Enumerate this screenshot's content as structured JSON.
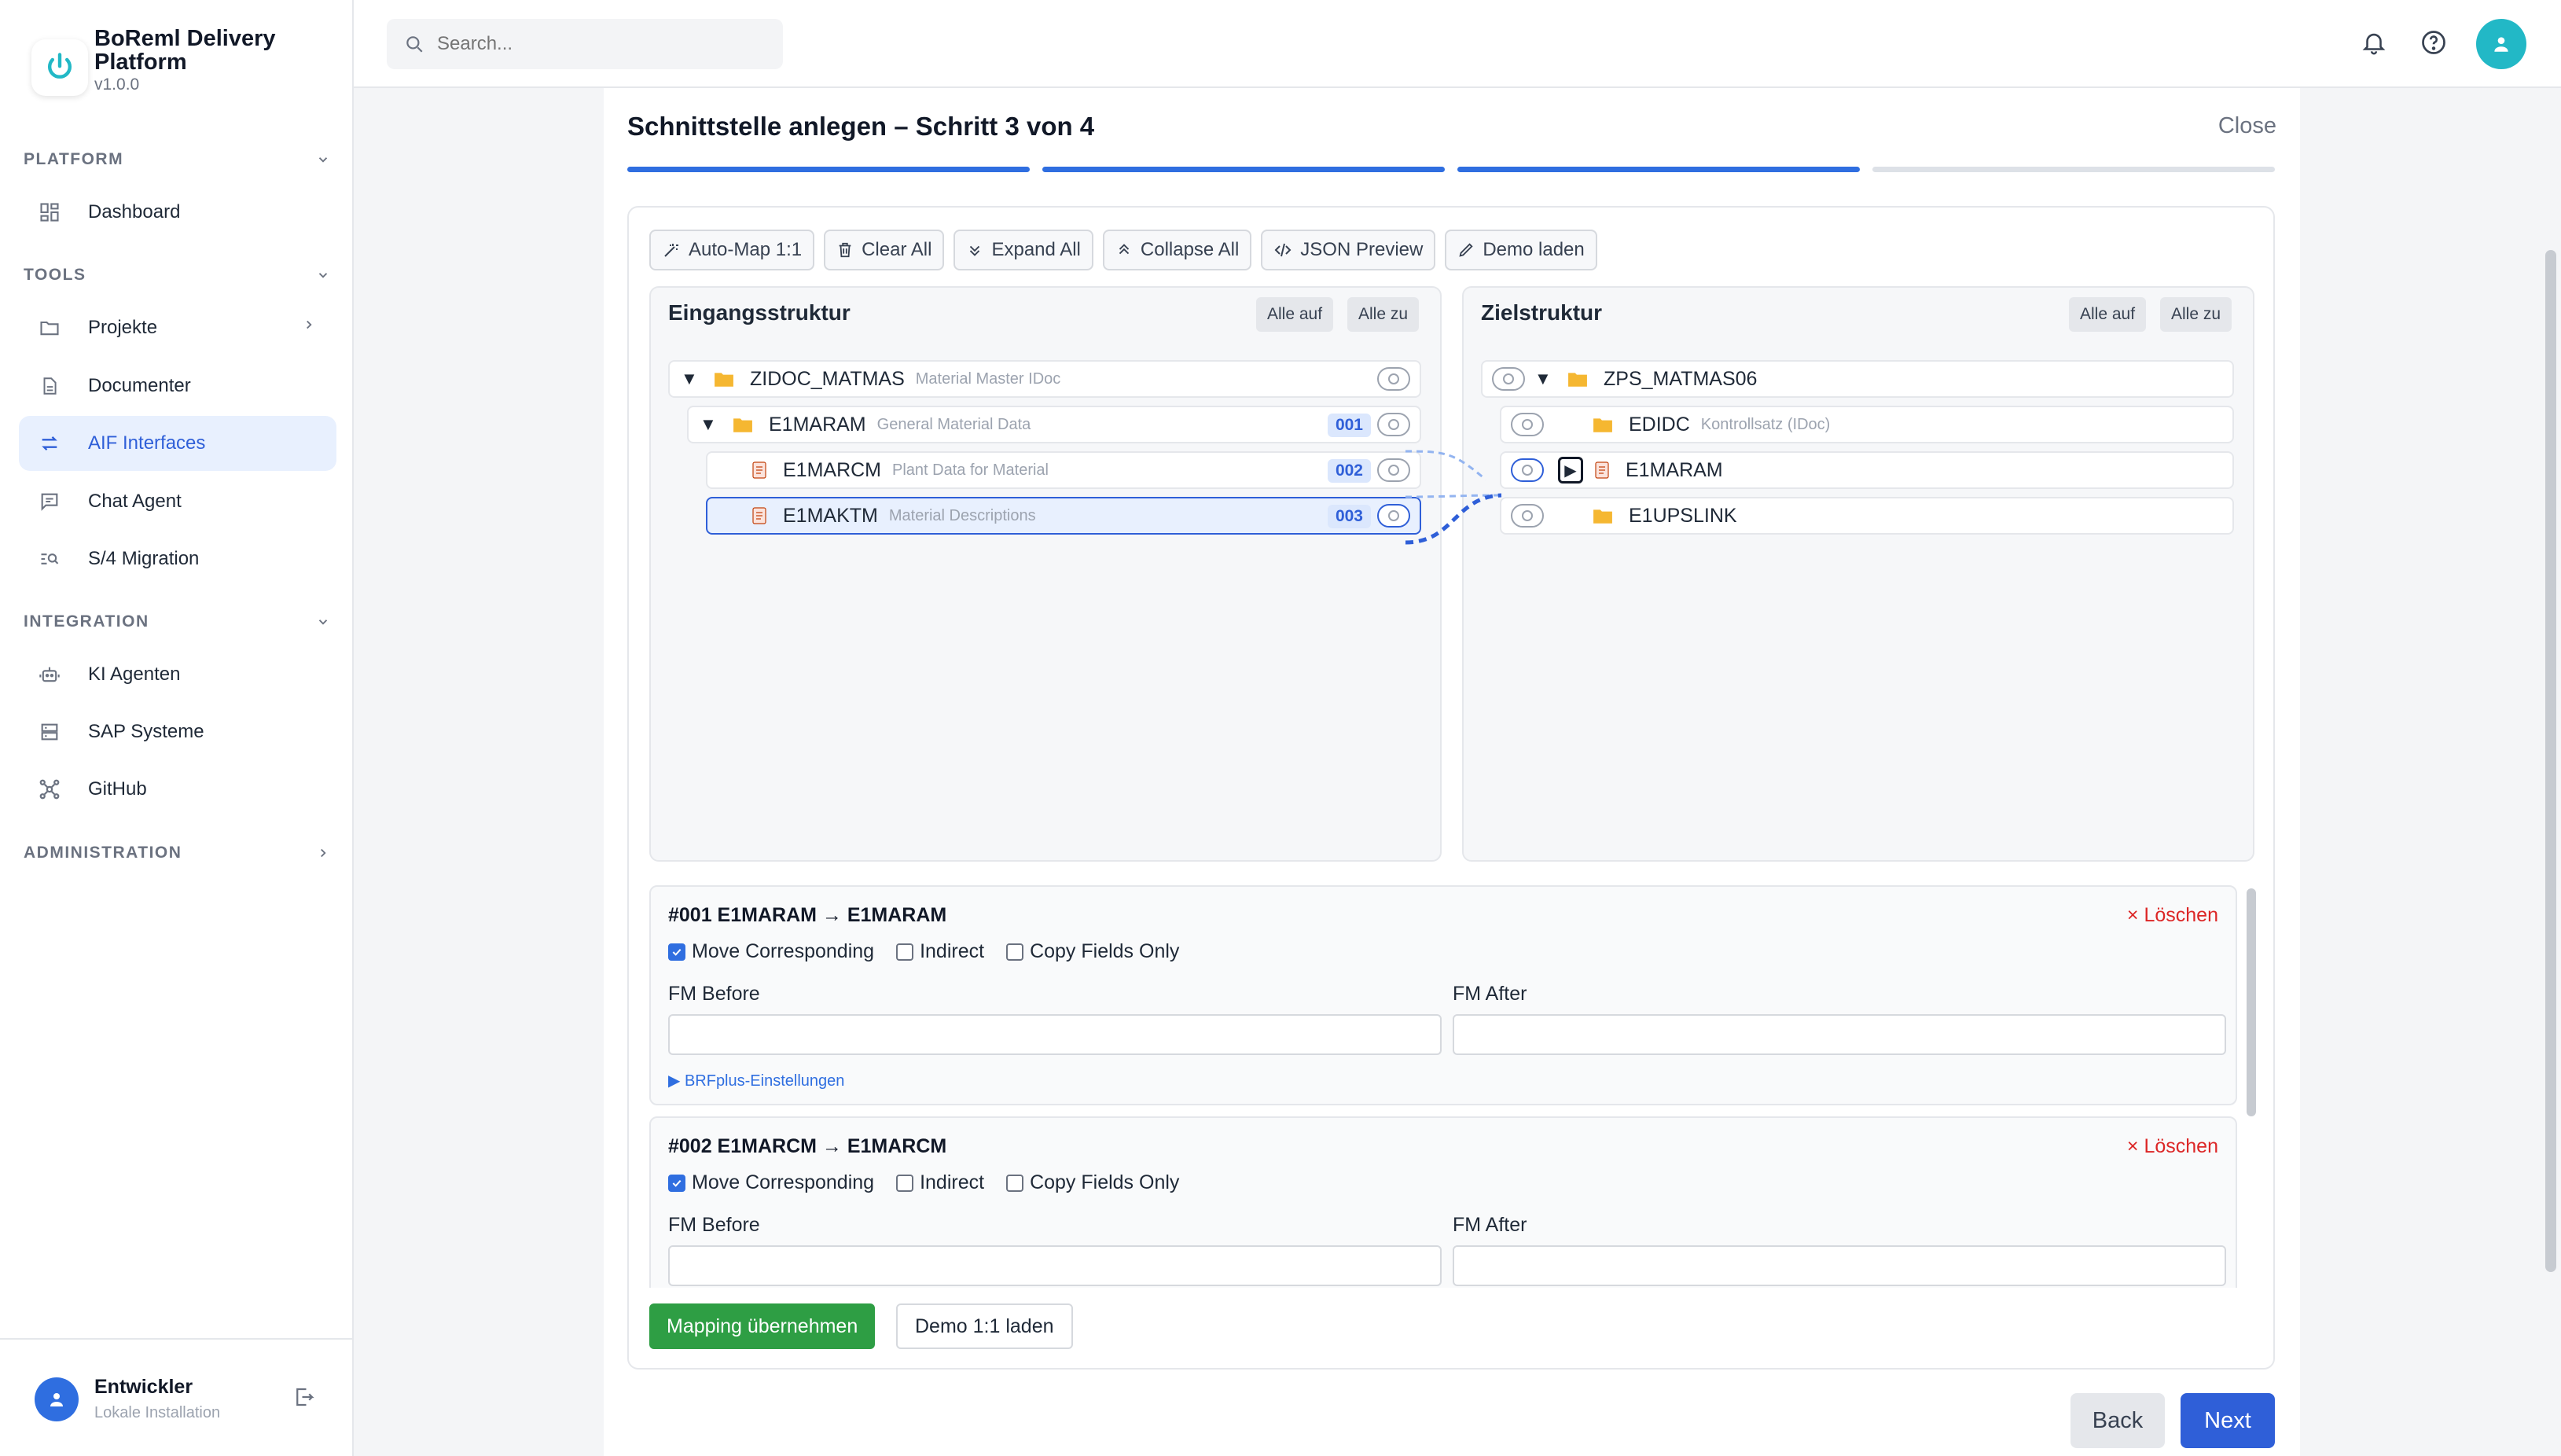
{
  "brand": {
    "title": "BoReml Delivery Platform",
    "version": "v1.0.0"
  },
  "sidebar": {
    "sections": [
      {
        "label": "PLATFORM",
        "items": [
          {
            "label": "Dashboard",
            "icon": "dashboard-icon"
          }
        ]
      },
      {
        "label": "TOOLS",
        "items": [
          {
            "label": "Projekte",
            "icon": "folder-icon"
          },
          {
            "label": "Documenter",
            "icon": "document-icon"
          },
          {
            "label": "AIF Interfaces",
            "icon": "arrows-icon"
          },
          {
            "label": "Chat Agent",
            "icon": "chat-icon"
          },
          {
            "label": "S/4 Migration",
            "icon": "migration-icon"
          }
        ]
      },
      {
        "label": "INTEGRATION",
        "items": [
          {
            "label": "KI Agenten",
            "icon": "robot-icon"
          },
          {
            "label": "SAP Systeme",
            "icon": "server-icon"
          },
          {
            "label": "GitHub",
            "icon": "network-icon"
          }
        ]
      },
      {
        "label": "ADMINISTRATION",
        "items": []
      }
    ],
    "user": {
      "name": "Entwickler",
      "subtitle": "Lokale Installation"
    }
  },
  "search": {
    "placeholder": "Search..."
  },
  "dialog": {
    "title": "Schnittstelle anlegen – Schritt 3 von 4",
    "close": "Close",
    "steps_done": 3,
    "steps_total": 4,
    "toolbar": [
      "Auto-Map 1:1",
      "Clear All",
      "Expand All",
      "Collapse All",
      "JSON Preview",
      "Demo laden"
    ],
    "source": {
      "title": "Eingangsstruktur",
      "expand_all": "Alle auf",
      "collapse_all": "Alle zu",
      "nodes": [
        {
          "name": "ZIDOC_MATMAS",
          "desc": "Material Master IDoc",
          "badge": ""
        },
        {
          "name": "E1MARAM",
          "desc": "General Material Data",
          "badge": "001"
        },
        {
          "name": "E1MARCM",
          "desc": "Plant Data for Material",
          "badge": "002"
        },
        {
          "name": "E1MAKTM",
          "desc": "Material Descriptions",
          "badge": "003"
        }
      ]
    },
    "target": {
      "title": "Zielstruktur",
      "expand_all": "Alle auf",
      "collapse_all": "Alle zu",
      "nodes": [
        {
          "name": "ZPS_MATMAS06",
          "desc": ""
        },
        {
          "name": "EDIDC",
          "desc": "Kontrollsatz (IDoc)"
        },
        {
          "name": "E1MARAM",
          "desc": ""
        },
        {
          "name": "E1UPSLINK",
          "desc": ""
        }
      ]
    },
    "mappings": [
      {
        "title": "#001 E1MARAM → E1MARAM",
        "delete": "× Löschen",
        "move_corr": "Move Corresponding",
        "indirect": "Indirect",
        "copy_only": "Copy Fields Only",
        "fm_before": "FM Before",
        "fm_after": "FM After",
        "brf": "▶ BRFplus-Einstellungen"
      },
      {
        "title": "#002 E1MARCM → E1MARCM",
        "delete": "× Löschen",
        "move_corr": "Move Corresponding",
        "indirect": "Indirect",
        "copy_only": "Copy Fields Only",
        "fm_before": "FM Before",
        "fm_after": "FM After"
      }
    ],
    "apply_mapping": "Mapping übernehmen",
    "demo_1to1": "Demo 1:1 laden",
    "back": "Back",
    "next": "Next"
  },
  "colors": {
    "primary": "#2f5fd8",
    "accent": "#22b8c6",
    "success": "#2e9e44",
    "danger": "#dc2626",
    "folder": "#f5b731"
  }
}
